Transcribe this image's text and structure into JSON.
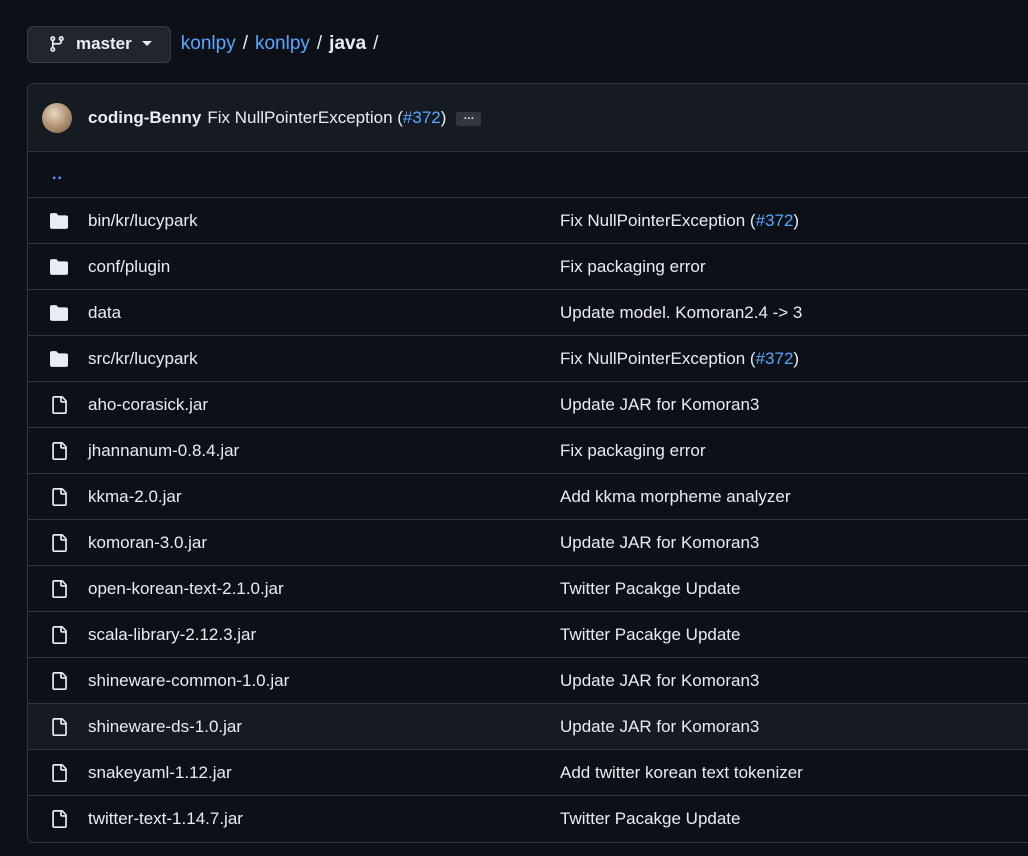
{
  "branch": {
    "name": "master"
  },
  "breadcrumb": {
    "parts": [
      "konlpy",
      "konlpy",
      "java"
    ],
    "separator": "/"
  },
  "latest_commit": {
    "author": "coding-Benny",
    "message_prefix": "Fix NullPointerException (",
    "pr": "#372",
    "message_suffix": ")",
    "ellipsis": "…"
  },
  "parent_link": "..",
  "files": [
    {
      "type": "folder",
      "name": "bin/kr/lucypark",
      "msg_prefix": "Fix NullPointerException (",
      "pr": "#372",
      "msg_suffix": ")"
    },
    {
      "type": "folder",
      "name": "conf/plugin",
      "msg_prefix": "Fix packaging error",
      "pr": "",
      "msg_suffix": ""
    },
    {
      "type": "folder",
      "name": "data",
      "msg_prefix": "Update model. Komoran2.4 -> 3",
      "pr": "",
      "msg_suffix": ""
    },
    {
      "type": "folder",
      "name": "src/kr/lucypark",
      "msg_prefix": "Fix NullPointerException (",
      "pr": "#372",
      "msg_suffix": ")"
    },
    {
      "type": "file",
      "name": "aho-corasick.jar",
      "msg_prefix": "Update JAR for Komoran3",
      "pr": "",
      "msg_suffix": ""
    },
    {
      "type": "file",
      "name": "jhannanum-0.8.4.jar",
      "msg_prefix": "Fix packaging error",
      "pr": "",
      "msg_suffix": ""
    },
    {
      "type": "file",
      "name": "kkma-2.0.jar",
      "msg_prefix": "Add kkma morpheme analyzer",
      "pr": "",
      "msg_suffix": ""
    },
    {
      "type": "file",
      "name": "komoran-3.0.jar",
      "msg_prefix": "Update JAR for Komoran3",
      "pr": "",
      "msg_suffix": ""
    },
    {
      "type": "file",
      "name": "open-korean-text-2.1.0.jar",
      "msg_prefix": "Twitter Pacakge Update",
      "pr": "",
      "msg_suffix": ""
    },
    {
      "type": "file",
      "name": "scala-library-2.12.3.jar",
      "msg_prefix": "Twitter Pacakge Update",
      "pr": "",
      "msg_suffix": ""
    },
    {
      "type": "file",
      "name": "shineware-common-1.0.jar",
      "msg_prefix": "Update JAR for Komoran3",
      "pr": "",
      "msg_suffix": ""
    },
    {
      "type": "file",
      "name": "shineware-ds-1.0.jar",
      "msg_prefix": "Update JAR for Komoran3",
      "pr": "",
      "msg_suffix": "",
      "hovered": true
    },
    {
      "type": "file",
      "name": "snakeyaml-1.12.jar",
      "msg_prefix": "Add twitter korean text tokenizer",
      "pr": "",
      "msg_suffix": ""
    },
    {
      "type": "file",
      "name": "twitter-text-1.14.7.jar",
      "msg_prefix": "Twitter Pacakge Update",
      "pr": "",
      "msg_suffix": ""
    }
  ],
  "colors": {
    "background": "#0d1117",
    "link": "#58a6ff",
    "border": "#30363d",
    "folder_icon": "#e6edf3",
    "file_icon": "#e6edf3"
  },
  "icons": {
    "branch": "git-branch-icon",
    "caret": "caret-down-icon",
    "folder": "folder-icon",
    "file": "file-icon"
  }
}
